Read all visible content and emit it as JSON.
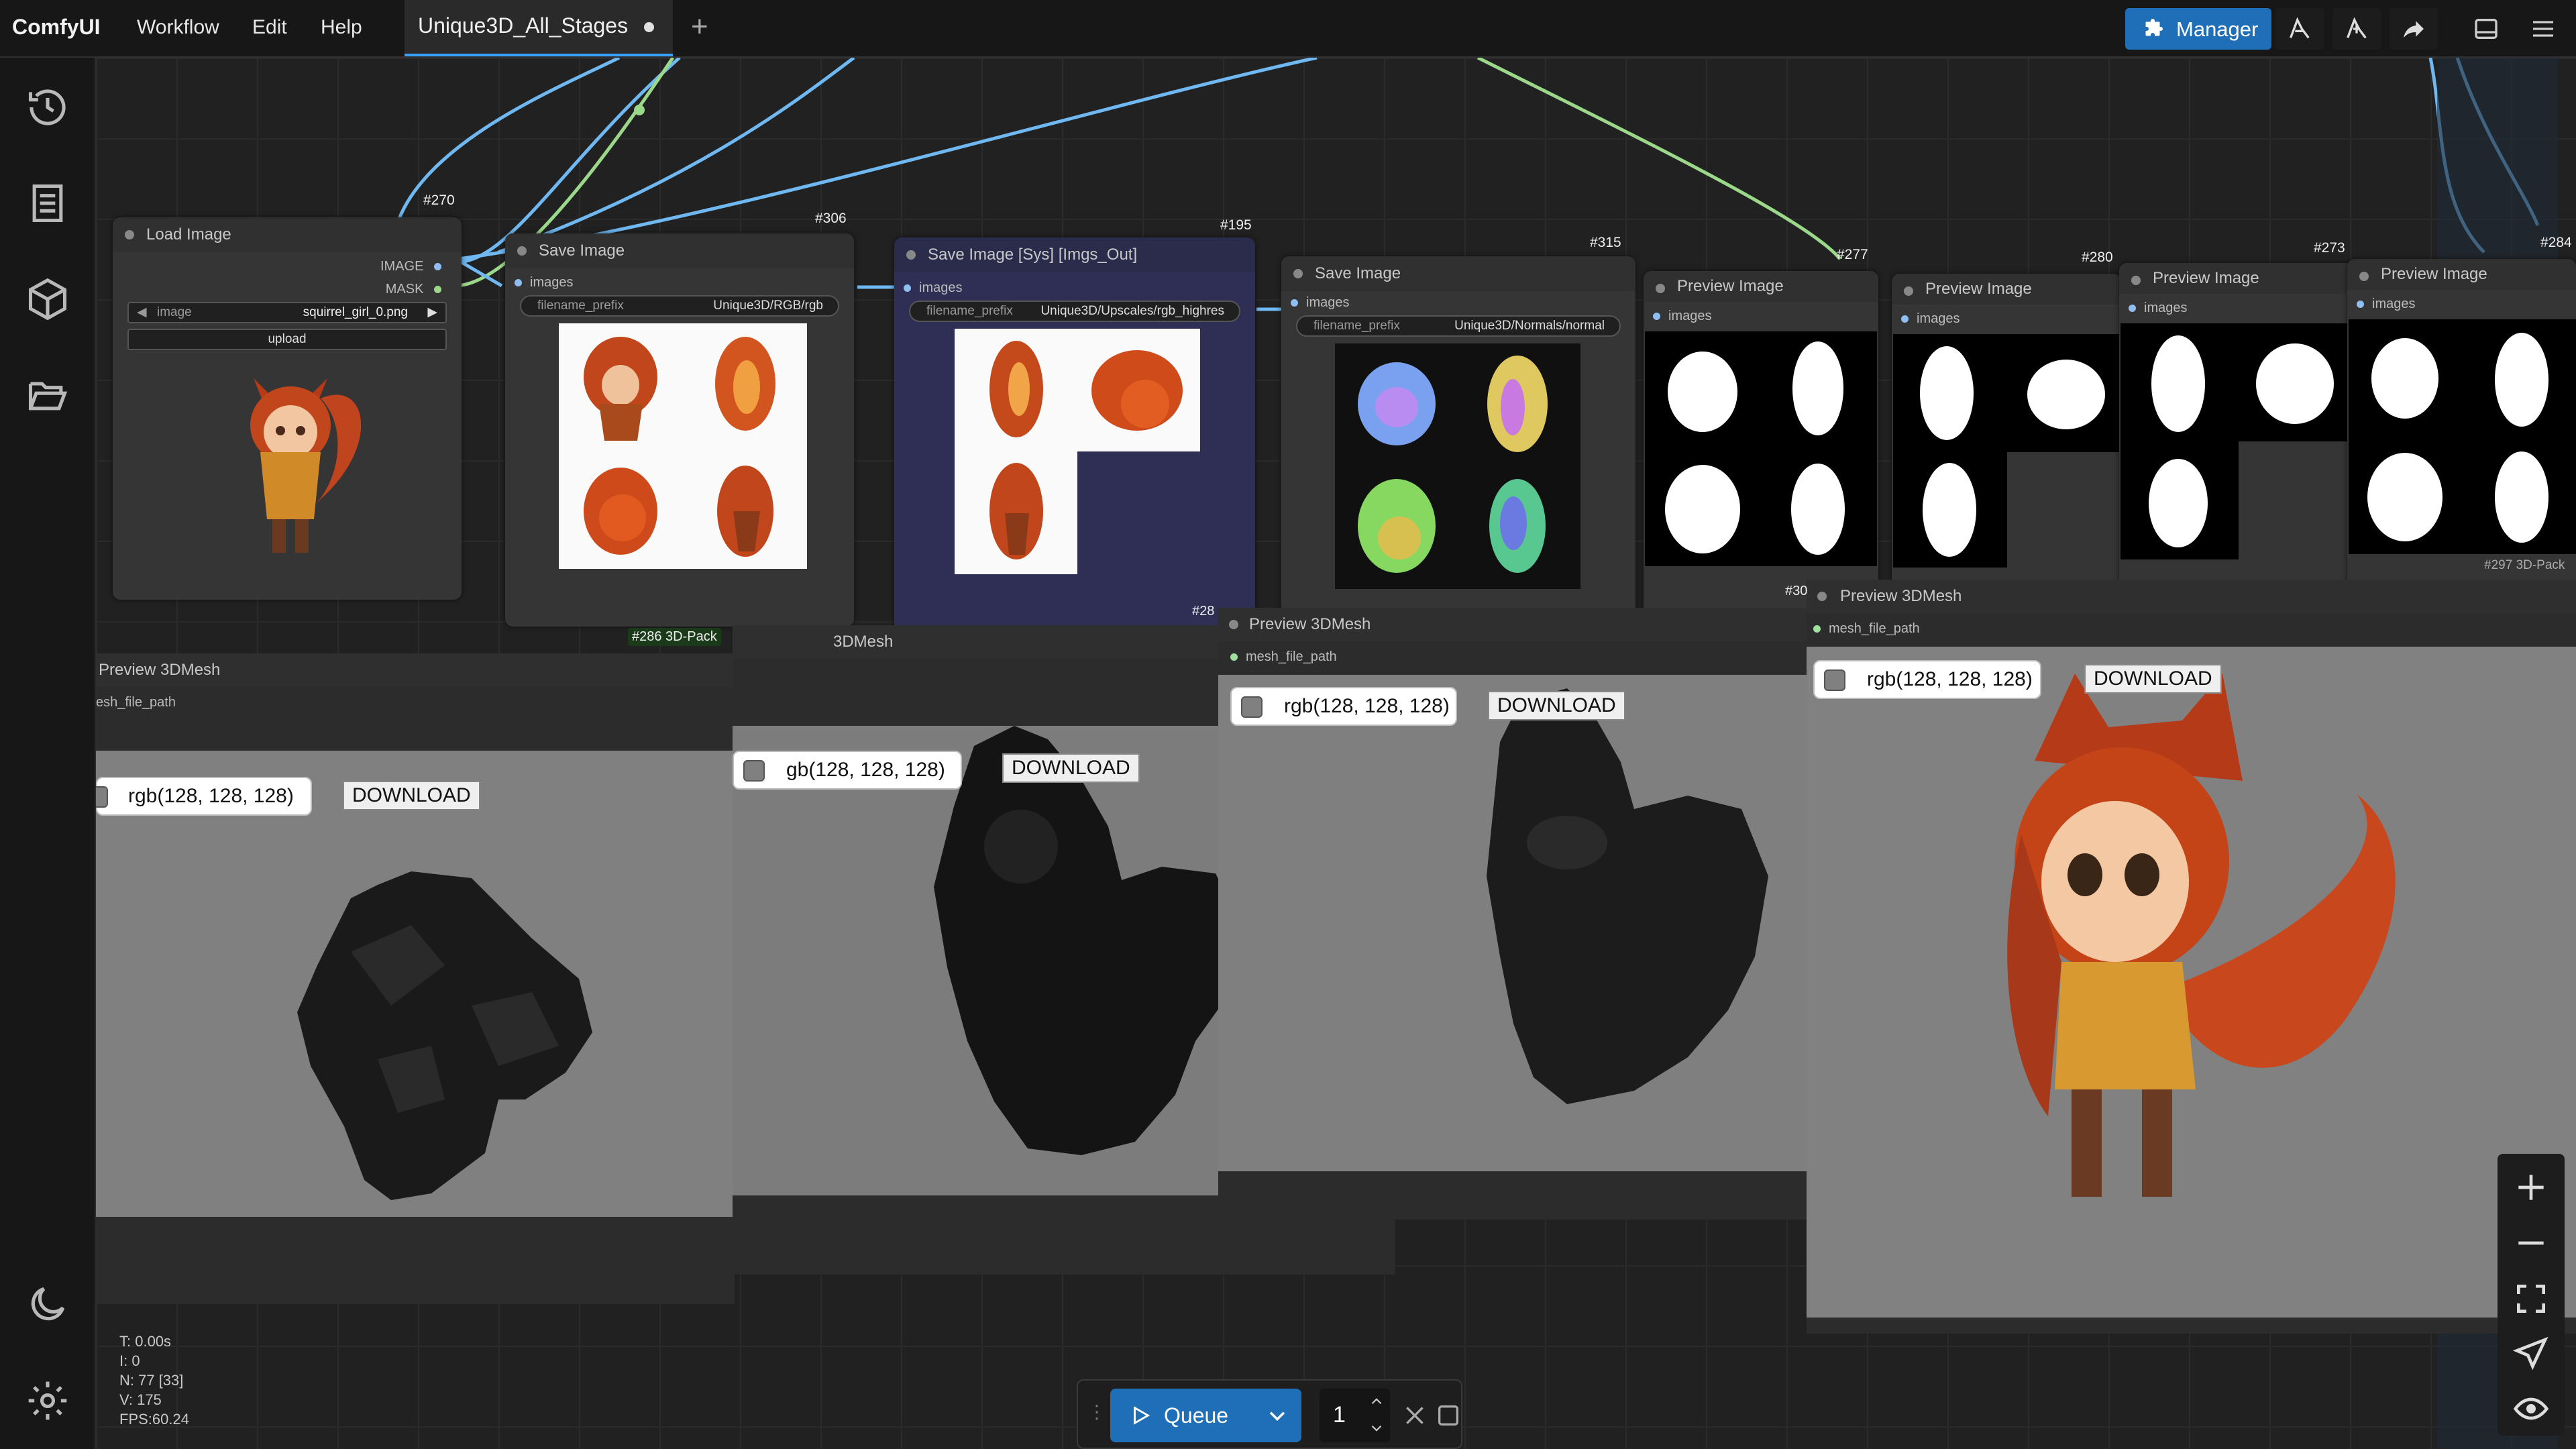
{
  "topbar": {
    "logo": "ComfyUI",
    "menu": [
      "Workflow",
      "Edit",
      "Help"
    ],
    "tab_title": "Unique3D_All_Stages",
    "manager_label": "Manager"
  },
  "nodes": {
    "load_image": {
      "id": "#270",
      "title": "Load Image",
      "out_image": "IMAGE",
      "out_mask": "MASK",
      "image_label": "image",
      "image_value": "squirrel_girl_0.png",
      "upload_label": "upload"
    },
    "save_rgb": {
      "id": "#306",
      "title": "Save Image",
      "input": "images",
      "prefix_label": "filename_prefix",
      "prefix_value": "Unique3D/RGB/rgb"
    },
    "save_sys": {
      "id": "#195",
      "title": "Save Image [Sys] [Imgs_Out]",
      "input": "images",
      "prefix_label": "filename_prefix",
      "prefix_value": "Unique3D/Upscales/rgb_highres"
    },
    "save_normals": {
      "id": "#315",
      "title": "Save Image",
      "input": "images",
      "prefix_label": "filename_prefix",
      "prefix_value": "Unique3D/Normals/normal"
    },
    "preview_277": {
      "id": "#277",
      "title": "Preview Image",
      "input": "images"
    },
    "preview_280": {
      "id": "#280",
      "title": "Preview Image",
      "input": "images"
    },
    "preview_273": {
      "id": "#273",
      "title": "Preview Image",
      "input": "images"
    },
    "preview_284": {
      "id": "#284",
      "title": "Preview Image",
      "input": "images"
    }
  },
  "previews3d": [
    {
      "title": "Preview 3DMesh",
      "input": "esh_file_path",
      "color": "rgb(128, 128, 128)",
      "download": "DOWNLOAD"
    },
    {
      "title": "3DMesh",
      "badge": "#286 3D-Pack",
      "input": "",
      "color": "rgb(128, 128, 128)",
      "color_visible": "gb(128, 128, 128)",
      "download": "DOWNLOAD"
    },
    {
      "title": "Preview 3DMesh",
      "badge": "#28",
      "input": "mesh_file_path",
      "color": "rgb(128, 128, 128)",
      "download": "DOWNLOAD"
    },
    {
      "title": "Preview 3DMesh",
      "badge": "#30",
      "input": "mesh_file_path",
      "color": "rgb(128, 128, 128)",
      "download": "DOWNLOAD"
    }
  ],
  "stray_label": "#297 3D-Pack",
  "stats": [
    "T: 0.00s",
    "I: 0",
    "N: 77 [33]",
    "V: 175",
    "FPS:60.24"
  ],
  "queue": {
    "label": "Queue",
    "count": "1"
  },
  "colors": {
    "accent": "#1f6fb8",
    "link_blue": "#6fb8f2",
    "link_green": "#9bd88a",
    "canvas": "#212121",
    "viewport": "#808080"
  },
  "icons": {
    "sidebar": [
      "history-icon",
      "queue-list-icon",
      "model-cube-icon",
      "workflow-folder-icon",
      "theme-moon-icon",
      "settings-gear-icon"
    ],
    "zoom": [
      "zoom-in-icon",
      "zoom-out-icon",
      "fit-view-icon",
      "select-mode-icon",
      "toggle-links-icon"
    ]
  }
}
